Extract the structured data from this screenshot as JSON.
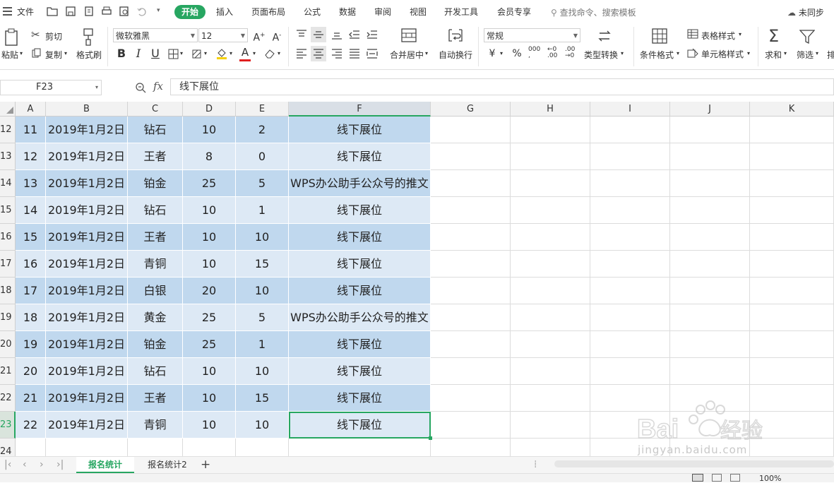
{
  "menubar": {
    "file_label": "文件",
    "tabs": [
      "开始",
      "插入",
      "页面布局",
      "公式",
      "数据",
      "审阅",
      "视图",
      "开发工具",
      "会员专享"
    ],
    "active_tab": "开始",
    "search_placeholder": "查找命令、搜索模板",
    "sync_label": "未同步"
  },
  "ribbon": {
    "paste_label": "粘贴",
    "cut_label": "剪切",
    "copy_label": "复制",
    "format_painter_label": "格式刷",
    "font_name": "微软雅黑",
    "font_size": "12",
    "bold_label": "B",
    "italic_label": "I",
    "underline_label": "U",
    "merge_center_label": "合并居中",
    "auto_wrap_label": "自动换行",
    "number_format": "常规",
    "currency_symbol": "¥",
    "percent_symbol": "%",
    "type_convert_label": "类型转换",
    "conditional_format_label": "条件格式",
    "table_style_label": "表格样式",
    "cell_style_label": "单元格样式",
    "sum_label": "求和",
    "filter_label": "筛选",
    "sort_label_partial": "排"
  },
  "formula_bar": {
    "name_box": "F23",
    "fx_label": "fx",
    "content": "线下展位"
  },
  "columns": [
    "A",
    "B",
    "C",
    "D",
    "E",
    "F",
    "G",
    "H",
    "I",
    "J",
    "K"
  ],
  "selected_column": "F",
  "rows": [
    {
      "row": "12",
      "cells": [
        "11",
        "2019年1月2日",
        "钻石",
        "10",
        "2",
        "线下展位"
      ]
    },
    {
      "row": "13",
      "cells": [
        "12",
        "2019年1月2日",
        "王者",
        "8",
        "0",
        "线下展位"
      ]
    },
    {
      "row": "14",
      "cells": [
        "13",
        "2019年1月2日",
        "铂金",
        "25",
        "5",
        "WPS办公助手公众号的推文"
      ]
    },
    {
      "row": "15",
      "cells": [
        "14",
        "2019年1月2日",
        "钻石",
        "10",
        "1",
        "线下展位"
      ]
    },
    {
      "row": "16",
      "cells": [
        "15",
        "2019年1月2日",
        "王者",
        "10",
        "10",
        "线下展位"
      ]
    },
    {
      "row": "17",
      "cells": [
        "16",
        "2019年1月2日",
        "青铜",
        "10",
        "15",
        "线下展位"
      ]
    },
    {
      "row": "18",
      "cells": [
        "17",
        "2019年1月2日",
        "白银",
        "20",
        "10",
        "线下展位"
      ]
    },
    {
      "row": "19",
      "cells": [
        "18",
        "2019年1月2日",
        "黄金",
        "25",
        "5",
        "WPS办公助手公众号的推文"
      ]
    },
    {
      "row": "20",
      "cells": [
        "19",
        "2019年1月2日",
        "铂金",
        "25",
        "1",
        "线下展位"
      ]
    },
    {
      "row": "21",
      "cells": [
        "20",
        "2019年1月2日",
        "钻石",
        "10",
        "10",
        "线下展位"
      ]
    },
    {
      "row": "22",
      "cells": [
        "21",
        "2019年1月2日",
        "王者",
        "10",
        "15",
        "线下展位"
      ]
    },
    {
      "row": "23",
      "cells": [
        "22",
        "2019年1月2日",
        "青铜",
        "10",
        "10",
        "线下展位"
      ]
    },
    {
      "row": "24",
      "cells": [
        "",
        "",
        "",
        "",
        "",
        ""
      ]
    }
  ],
  "selected_row": "23",
  "sheet_tabs": [
    "报名统计",
    "报名统计2"
  ],
  "active_sheet": "报名统计",
  "add_sheet_label": "+",
  "status": {
    "zoom": "100%"
  },
  "watermark": {
    "logo": "Bai du 经验",
    "url": "jingyan.baidu.com"
  },
  "colors": {
    "accent": "#27a661",
    "row_dark": "#c0d8ee",
    "row_light": "#dde9f5"
  }
}
